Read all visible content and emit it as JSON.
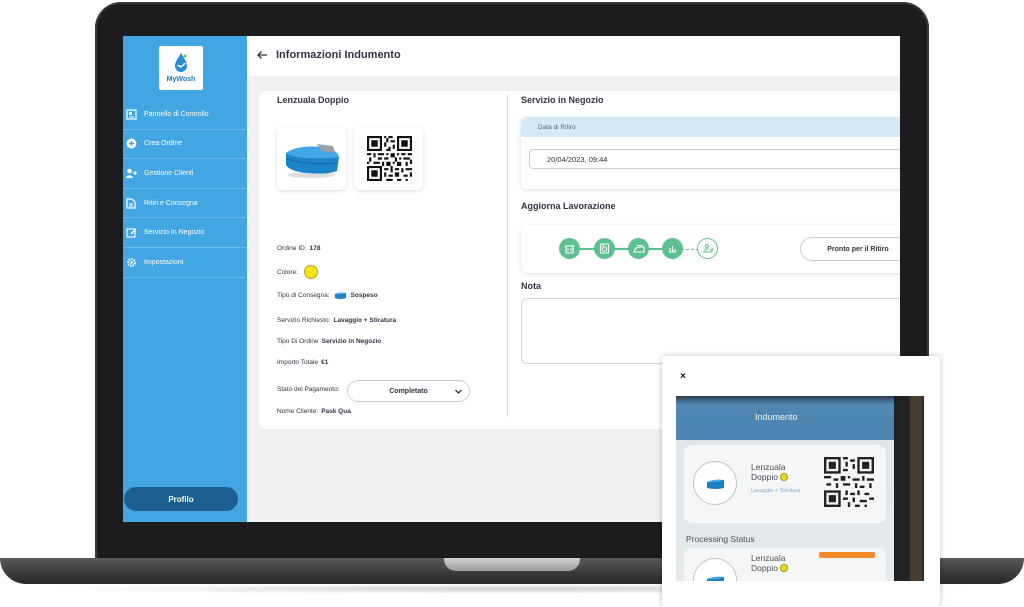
{
  "app": {
    "brand": "MyWosh",
    "page_title": "Informazioni Indumento"
  },
  "sidebar": {
    "items": [
      {
        "label": "Pannello di Controllo",
        "icon": "dashboard-icon"
      },
      {
        "label": "Crea Ordine",
        "icon": "plus-circle-icon"
      },
      {
        "label": "Gestione Clienti",
        "icon": "user-add-icon"
      },
      {
        "label": "Ritiri e Consegna",
        "icon": "document-icon"
      },
      {
        "label": "Servizio In Negozio",
        "icon": "edit-icon"
      },
      {
        "label": "Impostazioni",
        "icon": "gear-icon"
      }
    ],
    "profile_label": "Profilo"
  },
  "item": {
    "name": "Lenzuala Doppio",
    "order_id_label": "Ordine ID:",
    "order_id": "178",
    "color_label": "Colore:",
    "color_hex": "#f4e21c",
    "delivery_label": "Tipo di Consegna:",
    "delivery_value": "Sospeso",
    "service_label": "Servizio Richiesto:",
    "service_value": "Lavaggio + Stiratura",
    "order_type_label": "Tipo Di Ordine",
    "order_type_value": "Servizio in Negozio",
    "total_label": "Importo Totale",
    "total_value": "€1",
    "payment_label": "Stato del Pagamento:",
    "payment_value": "Completato",
    "customer_label": "Nome Cliente:",
    "customer_value": "Pask Qua"
  },
  "service": {
    "title": "Servizio in Negozio",
    "pickup_date_label": "Data di Ritiro",
    "pickup_date_value": "20/04/2023, 09:44"
  },
  "processing": {
    "title": "Aggiorna Lavorazione",
    "steps": [
      {
        "icon": "basket-icon",
        "done": true
      },
      {
        "icon": "washing-machine-icon",
        "done": true
      },
      {
        "icon": "iron-icon",
        "done": true
      },
      {
        "icon": "hanger-icon",
        "done": true
      },
      {
        "icon": "delivery-icon",
        "done": false
      }
    ],
    "ready_button_label": "Pronto per il Ritiro"
  },
  "note": {
    "title": "Nota"
  },
  "photo_popup": {
    "close_label": "×",
    "phone_header": "Indumento",
    "phone_item_name": "Lenzuala Doppio",
    "phone_item_service": "Lavaggio + Stiratura",
    "phone_section": "Processing Status",
    "phone_item_name_2": "Lenzuala Doppio"
  },
  "colors": {
    "sidebar": "#42a6e3",
    "profile_button": "#1b5e8f",
    "step_green": "#5ec08f",
    "accent_orange": "#f08a2b"
  }
}
